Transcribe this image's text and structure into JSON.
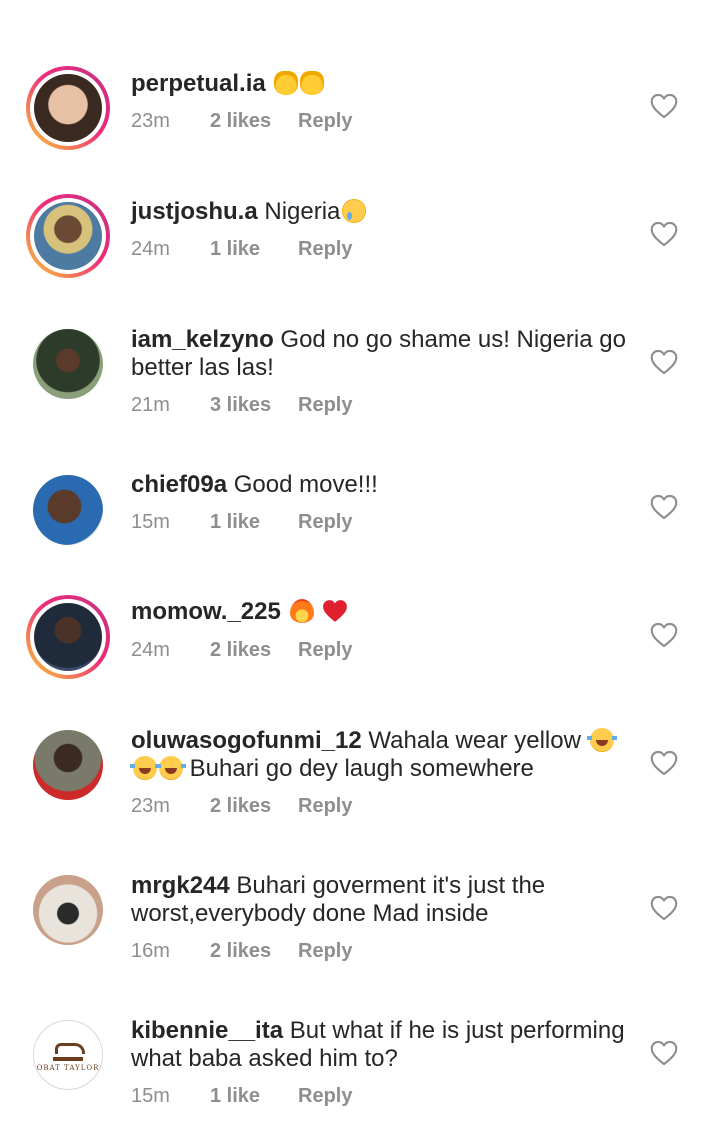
{
  "comments": [
    {
      "username": "perpetual.ia",
      "text": "",
      "emojis": [
        "raising-hands",
        "raising-hands"
      ],
      "time": "23m",
      "likes": "2 likes",
      "reply": "Reply",
      "story_ring": true
    },
    {
      "username": "justjoshu.a",
      "text": "Nigeria",
      "emojis": [
        "crying-face"
      ],
      "time": "24m",
      "likes": "1 like",
      "reply": "Reply",
      "story_ring": true
    },
    {
      "username": "iam_kelzyno",
      "text": "God no go shame us! Nigeria go better las las!",
      "emojis": [],
      "time": "21m",
      "likes": "3 likes",
      "reply": "Reply",
      "story_ring": false
    },
    {
      "username": "chief09a",
      "text": "Good move!!!",
      "emojis": [],
      "time": "15m",
      "likes": "1 like",
      "reply": "Reply",
      "story_ring": false
    },
    {
      "username": "momow._225",
      "text": "",
      "emojis": [
        "fire",
        "red-heart"
      ],
      "time": "24m",
      "likes": "2 likes",
      "reply": "Reply",
      "story_ring": true
    },
    {
      "username": "oluwasogofunmi_12",
      "text_a": "Wahala wear yellow",
      "text_b": "Buhari go dey laugh somewhere",
      "emojis": [
        "tears-of-joy",
        "tears-of-joy",
        "tears-of-joy"
      ],
      "time": "23m",
      "likes": "2 likes",
      "reply": "Reply",
      "story_ring": false
    },
    {
      "username": "mrgk244",
      "text": "Buhari goverment it's just the worst,everybody done Mad inside",
      "emojis": [],
      "time": "16m",
      "likes": "2 likes",
      "reply": "Reply",
      "story_ring": false
    },
    {
      "username": "kibennie__ita",
      "text": "But what if he is just performing what baba asked him to?",
      "emojis": [],
      "time": "15m",
      "likes": "1 like",
      "reply": "Reply",
      "story_ring": false,
      "avatar_logo_text": "OBAT TAYLOR"
    }
  ],
  "colors": {
    "text": "#262626",
    "meta": "#8e8e8e",
    "heart_outline": "#8e8e8e",
    "story_ring_start": "#f9ce34",
    "story_ring_end": "#c13584"
  },
  "icons": {
    "like": "heart-outline-icon"
  }
}
